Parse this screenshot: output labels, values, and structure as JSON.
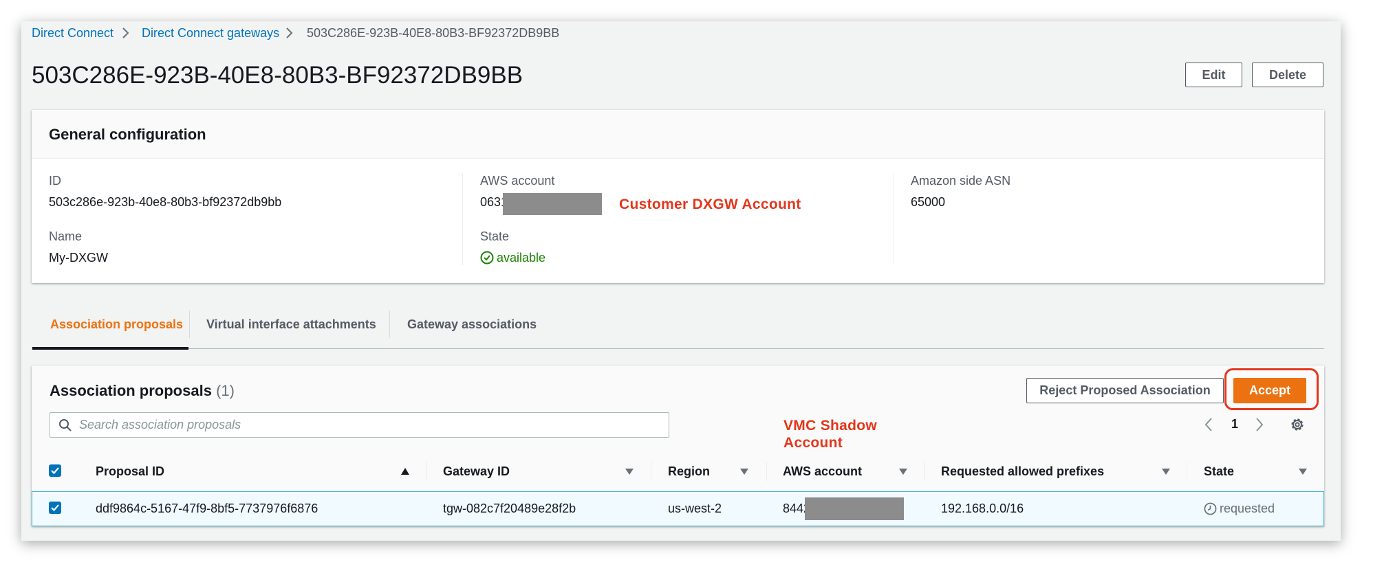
{
  "breadcrumb": {
    "items": [
      "Direct Connect",
      "Direct Connect gateways",
      "503C286E-923B-40E8-80B3-BF92372DB9BB"
    ]
  },
  "page": {
    "title": "503C286E-923B-40E8-80B3-BF92372DB9BB",
    "edit_label": "Edit",
    "delete_label": "Delete"
  },
  "general": {
    "heading": "General configuration",
    "id_label": "ID",
    "id_value": "503c286e-923b-40e8-80b3-bf92372db9bb",
    "name_label": "Name",
    "name_value": "My-DXGW",
    "account_label": "AWS account",
    "account_value": "0631",
    "state_label": "State",
    "state_value": "available",
    "asn_label": "Amazon side ASN",
    "asn_value": "65000"
  },
  "annotations": {
    "customer_account": "Customer DXGW Account",
    "vmc_line1": "VMC Shadow",
    "vmc_line2": "Account"
  },
  "tabs": [
    {
      "label": "Association proposals",
      "active": true
    },
    {
      "label": "Virtual interface attachments",
      "active": false
    },
    {
      "label": "Gateway associations",
      "active": false
    }
  ],
  "proposals": {
    "heading": "Association proposals",
    "count": "(1)",
    "reject_label": "Reject Proposed Association",
    "accept_label": "Accept",
    "search_placeholder": "Search association proposals",
    "page_number": "1",
    "columns": [
      "Proposal ID",
      "Gateway ID",
      "Region",
      "AWS account",
      "Requested allowed prefixes",
      "State"
    ],
    "rows": [
      {
        "proposal_id": "ddf9864c-5167-47f9-8bf5-7737976f6876",
        "gateway_id": "tgw-082c7f20489e28f2b",
        "region": "us-west-2",
        "aws_account": "8442",
        "prefixes": "192.168.0.0/16",
        "state": "requested"
      }
    ]
  },
  "colors": {
    "link": "#0073bb",
    "accent": "#ec7211",
    "success": "#1d8102",
    "annotation": "#e3361b"
  }
}
